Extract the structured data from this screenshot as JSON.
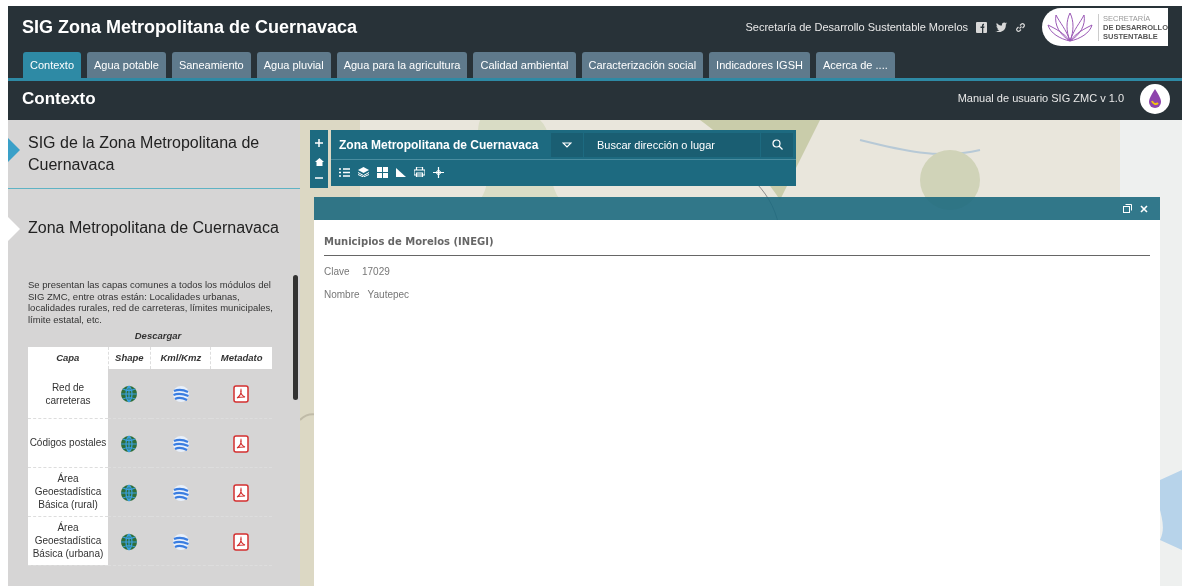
{
  "header": {
    "title": "SIG Zona Metropolitana de Cuernavaca",
    "org": "Secretaría de Desarrollo Sustentable Morelos",
    "logo_lines": [
      "SECRETARÍA",
      "DE DESARROLLO",
      "SUSTENTABLE"
    ]
  },
  "tabs": [
    {
      "label": "Contexto",
      "selected": true
    },
    {
      "label": "Agua potable",
      "selected": false
    },
    {
      "label": "Saneamiento",
      "selected": false
    },
    {
      "label": "Agua pluvial",
      "selected": false
    },
    {
      "label": "Agua para la agricultura",
      "selected": false
    },
    {
      "label": "Calidad ambiental",
      "selected": false
    },
    {
      "label": "Caracterización social",
      "selected": false
    },
    {
      "label": "Indicadores IGSH",
      "selected": false
    },
    {
      "label": "Acerca de ....",
      "selected": false
    }
  ],
  "subheader": {
    "heading": "Contexto",
    "manual_link": "Manual de usuario SIG ZMC v 1.0"
  },
  "sidebar": {
    "sections": [
      {
        "title": "SIG de la Zona Metropolitana de Cuernavaca",
        "expanded": false
      },
      {
        "title": "Zona Metropolitana de Cuernavaca",
        "expanded": true
      }
    ],
    "description": "Se presentan las capas comunes a todos los módulos del SIG ZMC, entre otras están: Localidades urbanas, localidades rurales, red de carreteras, límites municipales, límite estatal, etc.",
    "table": {
      "caption": "Descargar",
      "columns": [
        "Capa",
        "Shape",
        "Kml/Kmz",
        "Metadato"
      ],
      "rows": [
        {
          "capa": "Red de carreteras"
        },
        {
          "capa": "Códigos postales"
        },
        {
          "capa": "Área Geoestadística Básica (rural)"
        },
        {
          "capa": "Área Geoestadística Básica (urbana)"
        }
      ]
    }
  },
  "map": {
    "title": "Zona Metropolitana de Cuernavaca",
    "search": {
      "placeholder": "Buscar dirección o lugar"
    },
    "popup": {
      "layer": "Municipios de Morelos (INEGI)",
      "fields": [
        {
          "label": "Clave",
          "value": "17029"
        },
        {
          "label": "Nombre",
          "value": "Yautepec"
        }
      ]
    }
  }
}
